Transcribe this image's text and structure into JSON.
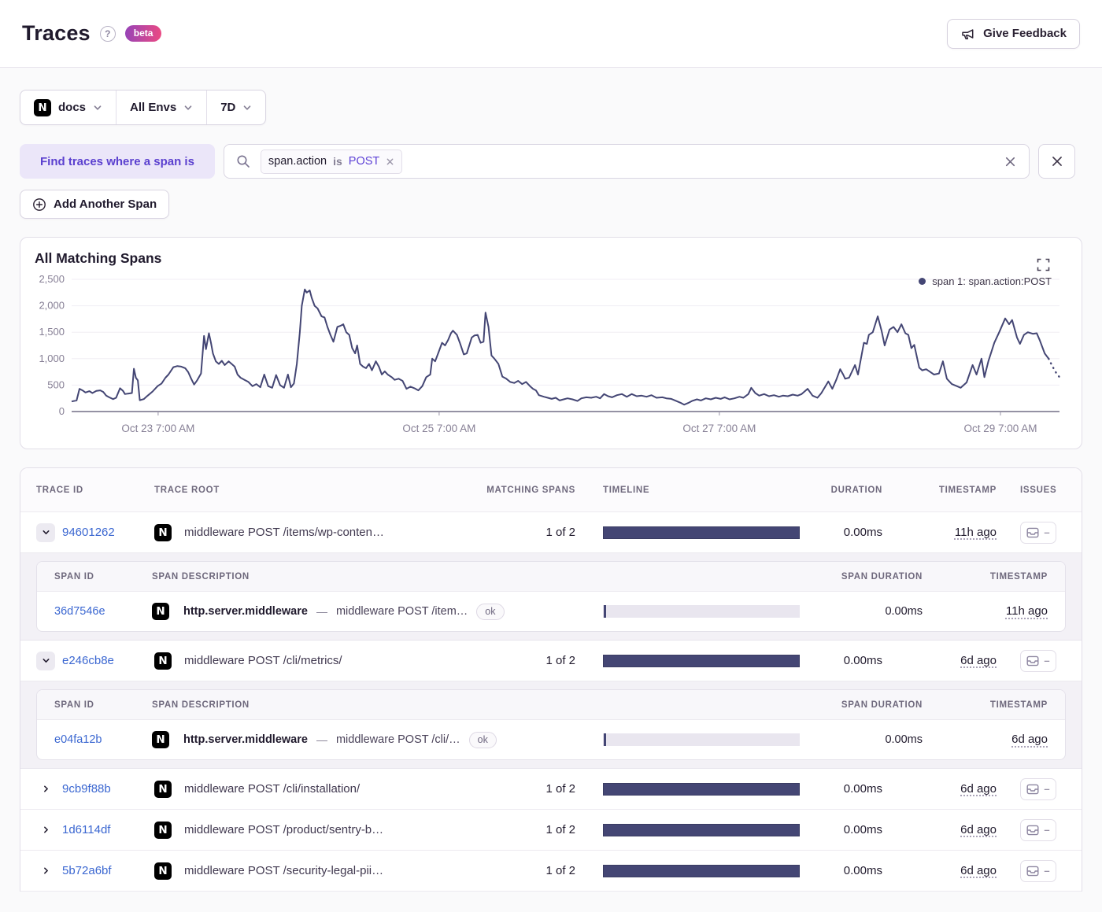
{
  "header": {
    "title": "Traces",
    "beta_label": "beta",
    "feedback_label": "Give Feedback"
  },
  "filters": {
    "project": "docs",
    "environment": "All Envs",
    "period": "7D"
  },
  "query": {
    "find_label": "Find traces where a span is",
    "token": {
      "key": "span.action",
      "operator": "is",
      "value": "POST"
    },
    "add_span_label": "Add Another Span"
  },
  "chart_data": {
    "type": "line",
    "title": "All Matching Spans",
    "legend_label": "span 1: span.action:POST",
    "legend_position": "top-right",
    "line_color": "#444674",
    "grid": true,
    "ylim": [
      0,
      2500
    ],
    "y_ticks": [
      {
        "value": 0,
        "label": "0"
      },
      {
        "value": 500,
        "label": "500"
      },
      {
        "value": 1000,
        "label": "1,000"
      },
      {
        "value": 1500,
        "label": "1,500"
      },
      {
        "value": 2000,
        "label": "2,000"
      },
      {
        "value": 2500,
        "label": "2,500"
      }
    ],
    "x_ticks": [
      {
        "t": 0.0876,
        "label": "Oct 23 7:00 AM"
      },
      {
        "t": 0.372,
        "label": "Oct 25 7:00 AM"
      },
      {
        "t": 0.6557,
        "label": "Oct 27 7:00 AM"
      },
      {
        "t": 0.9402,
        "label": "Oct 29 7:00 AM"
      }
    ],
    "series": [
      {
        "name": "span 1: span.action:POST",
        "tail_dotted_points": 4,
        "points": [
          [
            0.0,
            190
          ],
          [
            0.005,
            210
          ],
          [
            0.008,
            430
          ],
          [
            0.011,
            400
          ],
          [
            0.014,
            360
          ],
          [
            0.018,
            385
          ],
          [
            0.021,
            350
          ],
          [
            0.025,
            390
          ],
          [
            0.029,
            400
          ],
          [
            0.032,
            370
          ],
          [
            0.035,
            300
          ],
          [
            0.038,
            270
          ],
          [
            0.042,
            235
          ],
          [
            0.045,
            260
          ],
          [
            0.049,
            440
          ],
          [
            0.052,
            390
          ],
          [
            0.054,
            330
          ],
          [
            0.057,
            340
          ],
          [
            0.061,
            350
          ],
          [
            0.063,
            810
          ],
          [
            0.065,
            640
          ],
          [
            0.067,
            590
          ],
          [
            0.069,
            215
          ],
          [
            0.073,
            235
          ],
          [
            0.077,
            300
          ],
          [
            0.082,
            380
          ],
          [
            0.087,
            480
          ],
          [
            0.091,
            530
          ],
          [
            0.095,
            640
          ],
          [
            0.098,
            700
          ],
          [
            0.103,
            840
          ],
          [
            0.107,
            860
          ],
          [
            0.111,
            850
          ],
          [
            0.115,
            820
          ],
          [
            0.118,
            745
          ],
          [
            0.121,
            620
          ],
          [
            0.124,
            510
          ],
          [
            0.127,
            590
          ],
          [
            0.131,
            720
          ],
          [
            0.134,
            1430
          ],
          [
            0.136,
            1180
          ],
          [
            0.139,
            1480
          ],
          [
            0.141,
            1300
          ],
          [
            0.143,
            1100
          ],
          [
            0.146,
            950
          ],
          [
            0.149,
            900
          ],
          [
            0.152,
            960
          ],
          [
            0.155,
            880
          ],
          [
            0.159,
            950
          ],
          [
            0.162,
            900
          ],
          [
            0.165,
            850
          ],
          [
            0.168,
            700
          ],
          [
            0.171,
            640
          ],
          [
            0.175,
            600
          ],
          [
            0.179,
            560
          ],
          [
            0.183,
            480
          ],
          [
            0.187,
            520
          ],
          [
            0.191,
            460
          ],
          [
            0.195,
            700
          ],
          [
            0.199,
            480
          ],
          [
            0.203,
            450
          ],
          [
            0.207,
            690
          ],
          [
            0.211,
            500
          ],
          [
            0.215,
            450
          ],
          [
            0.219,
            700
          ],
          [
            0.222,
            460
          ],
          [
            0.225,
            530
          ],
          [
            0.228,
            900
          ],
          [
            0.231,
            1500
          ],
          [
            0.233,
            2000
          ],
          [
            0.236,
            2310
          ],
          [
            0.238,
            2250
          ],
          [
            0.241,
            2290
          ],
          [
            0.243,
            2150
          ],
          [
            0.246,
            2000
          ],
          [
            0.249,
            1950
          ],
          [
            0.253,
            1800
          ],
          [
            0.256,
            1780
          ],
          [
            0.259,
            1600
          ],
          [
            0.262,
            1450
          ],
          [
            0.265,
            1320
          ],
          [
            0.269,
            1600
          ],
          [
            0.272,
            1620
          ],
          [
            0.275,
            1650
          ],
          [
            0.278,
            1500
          ],
          [
            0.281,
            1450
          ],
          [
            0.284,
            1200
          ],
          [
            0.287,
            1100
          ],
          [
            0.289,
            1250
          ],
          [
            0.292,
            900
          ],
          [
            0.295,
            850
          ],
          [
            0.298,
            820
          ],
          [
            0.301,
            900
          ],
          [
            0.304,
            780
          ],
          [
            0.308,
            950
          ],
          [
            0.311,
            850
          ],
          [
            0.314,
            700
          ],
          [
            0.317,
            760
          ],
          [
            0.32,
            700
          ],
          [
            0.324,
            650
          ],
          [
            0.327,
            600
          ],
          [
            0.331,
            620
          ],
          [
            0.335,
            580
          ],
          [
            0.339,
            430
          ],
          [
            0.343,
            470
          ],
          [
            0.347,
            440
          ],
          [
            0.351,
            400
          ],
          [
            0.355,
            480
          ],
          [
            0.359,
            650
          ],
          [
            0.363,
            700
          ],
          [
            0.365,
            1000
          ],
          [
            0.368,
            950
          ],
          [
            0.371,
            1100
          ],
          [
            0.375,
            1300
          ],
          [
            0.378,
            1250
          ],
          [
            0.381,
            1350
          ],
          [
            0.384,
            1480
          ],
          [
            0.386,
            1530
          ],
          [
            0.39,
            1450
          ],
          [
            0.393,
            1300
          ],
          [
            0.397,
            1080
          ],
          [
            0.4,
            1100
          ],
          [
            0.405,
            1400
          ],
          [
            0.408,
            1440
          ],
          [
            0.411,
            1450
          ],
          [
            0.414,
            1300
          ],
          [
            0.417,
            1320
          ],
          [
            0.419,
            1870
          ],
          [
            0.422,
            1600
          ],
          [
            0.425,
            1060
          ],
          [
            0.428,
            1000
          ],
          [
            0.432,
            900
          ],
          [
            0.436,
            660
          ],
          [
            0.44,
            620
          ],
          [
            0.444,
            560
          ],
          [
            0.448,
            540
          ],
          [
            0.452,
            580
          ],
          [
            0.456,
            520
          ],
          [
            0.46,
            560
          ],
          [
            0.464,
            480
          ],
          [
            0.467,
            430
          ],
          [
            0.47,
            400
          ],
          [
            0.473,
            310
          ],
          [
            0.478,
            280
          ],
          [
            0.482,
            260
          ],
          [
            0.486,
            240
          ],
          [
            0.49,
            260
          ],
          [
            0.494,
            210
          ],
          [
            0.498,
            230
          ],
          [
            0.502,
            250
          ],
          [
            0.507,
            230
          ],
          [
            0.512,
            200
          ],
          [
            0.516,
            250
          ],
          [
            0.521,
            270
          ],
          [
            0.526,
            260
          ],
          [
            0.531,
            280
          ],
          [
            0.535,
            250
          ],
          [
            0.539,
            330
          ],
          [
            0.543,
            290
          ],
          [
            0.547,
            270
          ],
          [
            0.552,
            310
          ],
          [
            0.557,
            330
          ],
          [
            0.562,
            280
          ],
          [
            0.567,
            330
          ],
          [
            0.572,
            290
          ],
          [
            0.577,
            300
          ],
          [
            0.582,
            280
          ],
          [
            0.587,
            310
          ],
          [
            0.592,
            260
          ],
          [
            0.598,
            270
          ],
          [
            0.602,
            250
          ],
          [
            0.607,
            240
          ],
          [
            0.612,
            200
          ],
          [
            0.617,
            160
          ],
          [
            0.62,
            130
          ],
          [
            0.624,
            160
          ],
          [
            0.628,
            200
          ],
          [
            0.633,
            230
          ],
          [
            0.637,
            210
          ],
          [
            0.642,
            250
          ],
          [
            0.647,
            230
          ],
          [
            0.652,
            260
          ],
          [
            0.657,
            240
          ],
          [
            0.661,
            270
          ],
          [
            0.666,
            230
          ],
          [
            0.671,
            250
          ],
          [
            0.676,
            280
          ],
          [
            0.68,
            260
          ],
          [
            0.685,
            330
          ],
          [
            0.688,
            450
          ],
          [
            0.692,
            350
          ],
          [
            0.696,
            300
          ],
          [
            0.701,
            330
          ],
          [
            0.706,
            290
          ],
          [
            0.711,
            310
          ],
          [
            0.716,
            280
          ],
          [
            0.72,
            300
          ],
          [
            0.725,
            290
          ],
          [
            0.73,
            320
          ],
          [
            0.735,
            300
          ],
          [
            0.739,
            330
          ],
          [
            0.745,
            430
          ],
          [
            0.75,
            300
          ],
          [
            0.755,
            260
          ],
          [
            0.759,
            350
          ],
          [
            0.766,
            570
          ],
          [
            0.77,
            430
          ],
          [
            0.774,
            600
          ],
          [
            0.778,
            800
          ],
          [
            0.781,
            700
          ],
          [
            0.783,
            620
          ],
          [
            0.787,
            640
          ],
          [
            0.793,
            880
          ],
          [
            0.796,
            700
          ],
          [
            0.798,
            900
          ],
          [
            0.802,
            1300
          ],
          [
            0.805,
            1280
          ],
          [
            0.807,
            1450
          ],
          [
            0.811,
            1500
          ],
          [
            0.816,
            1800
          ],
          [
            0.82,
            1520
          ],
          [
            0.823,
            1250
          ],
          [
            0.828,
            1550
          ],
          [
            0.832,
            1600
          ],
          [
            0.836,
            1500
          ],
          [
            0.84,
            1650
          ],
          [
            0.844,
            1480
          ],
          [
            0.847,
            1450
          ],
          [
            0.85,
            1200
          ],
          [
            0.853,
            1260
          ],
          [
            0.858,
            830
          ],
          [
            0.861,
            780
          ],
          [
            0.865,
            800
          ],
          [
            0.869,
            750
          ],
          [
            0.873,
            700
          ],
          [
            0.878,
            720
          ],
          [
            0.882,
            950
          ],
          [
            0.886,
            620
          ],
          [
            0.891,
            520
          ],
          [
            0.896,
            480
          ],
          [
            0.9,
            450
          ],
          [
            0.906,
            550
          ],
          [
            0.912,
            880
          ],
          [
            0.916,
            700
          ],
          [
            0.921,
            1000
          ],
          [
            0.924,
            650
          ],
          [
            0.928,
            950
          ],
          [
            0.934,
            1300
          ],
          [
            0.939,
            1500
          ],
          [
            0.945,
            1760
          ],
          [
            0.949,
            1650
          ],
          [
            0.952,
            1730
          ],
          [
            0.957,
            1400
          ],
          [
            0.96,
            1280
          ],
          [
            0.964,
            1450
          ],
          [
            0.968,
            1500
          ],
          [
            0.973,
            1470
          ],
          [
            0.977,
            1480
          ],
          [
            0.98,
            1350
          ],
          [
            0.985,
            1100
          ],
          [
            0.989,
            1000
          ],
          [
            0.993,
            850
          ],
          [
            0.997,
            720
          ],
          [
            1.0,
            650
          ]
        ]
      }
    ]
  },
  "table": {
    "columns": [
      "TRACE ID",
      "TRACE ROOT",
      "MATCHING SPANS",
      "TIMELINE",
      "DURATION",
      "TIMESTAMP",
      "ISSUES"
    ],
    "sub_columns": [
      "SPAN ID",
      "SPAN DESCRIPTION",
      "SPAN DURATION",
      "TIMESTAMP"
    ],
    "rows": [
      {
        "id": "94601262",
        "expanded": true,
        "root": "middleware POST /items/wp-conten…",
        "matching": "1 of 2",
        "duration": "0.00ms",
        "timestamp": "11h ago",
        "issues": "–",
        "spans": [
          {
            "id": "36d7546e",
            "op": "http.server.middleware",
            "description": "middleware POST /item…",
            "status": "ok",
            "duration": "0.00ms",
            "timestamp": "11h ago"
          }
        ]
      },
      {
        "id": "e246cb8e",
        "expanded": true,
        "root": "middleware POST /cli/metrics/",
        "matching": "1 of 2",
        "duration": "0.00ms",
        "timestamp": "6d ago",
        "issues": "–",
        "spans": [
          {
            "id": "e04fa12b",
            "op": "http.server.middleware",
            "description": "middleware POST /cli/…",
            "status": "ok",
            "duration": "0.00ms",
            "timestamp": "6d ago"
          }
        ]
      },
      {
        "id": "9cb9f88b",
        "expanded": false,
        "root": "middleware POST /cli/installation/",
        "matching": "1 of 2",
        "duration": "0.00ms",
        "timestamp": "6d ago",
        "issues": "–",
        "spans": []
      },
      {
        "id": "1d6114df",
        "expanded": false,
        "root": "middleware POST /product/sentry-b…",
        "matching": "1 of 2",
        "duration": "0.00ms",
        "timestamp": "6d ago",
        "issues": "–",
        "spans": []
      },
      {
        "id": "5b72a6bf",
        "expanded": false,
        "root": "middleware POST /security-legal-pii…",
        "matching": "1 of 2",
        "duration": "0.00ms",
        "timestamp": "6d ago",
        "issues": "–",
        "spans": []
      }
    ]
  },
  "colors": {
    "accent_purple": "#5b40cf",
    "link_blue": "#3b67d1",
    "bar_navy": "#444674",
    "beta_gradient_start": "#9643b8",
    "beta_gradient_end": "#ec4a82"
  }
}
